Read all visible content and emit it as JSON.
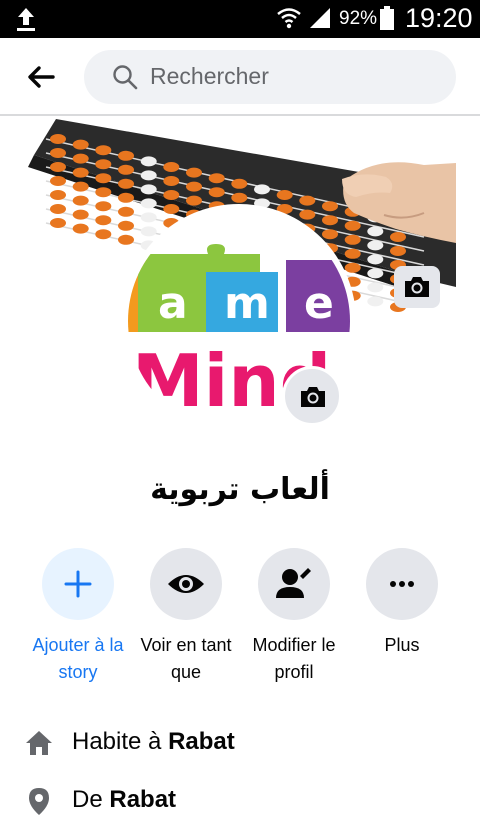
{
  "status_bar": {
    "battery_percent": "92%",
    "time": "19:20"
  },
  "header": {
    "search_placeholder": "Rechercher"
  },
  "profile": {
    "name": "ألعاب تربوية",
    "avatar_logo_text_top": [
      "a",
      "m",
      "e"
    ],
    "avatar_logo_text_bottom": "Mind"
  },
  "actions": [
    {
      "label": "Ajouter à la story",
      "icon": "plus-icon"
    },
    {
      "label": "Voir en tant que",
      "icon": "eye-icon"
    },
    {
      "label": "Modifier le profil",
      "icon": "edit-profile-icon"
    },
    {
      "label": "Plus",
      "icon": "more-icon"
    }
  ],
  "info": [
    {
      "prefix": "Habite à",
      "value": "Rabat",
      "icon": "home-icon"
    },
    {
      "prefix": "De",
      "value": "Rabat",
      "icon": "location-pin-icon"
    }
  ],
  "colors": {
    "accent": "#1877f2",
    "accent_bg": "#e7f3ff",
    "button_bg": "#e4e6eb",
    "search_bg": "#f0f2f5",
    "text": "#050505",
    "muted": "#65676b"
  }
}
